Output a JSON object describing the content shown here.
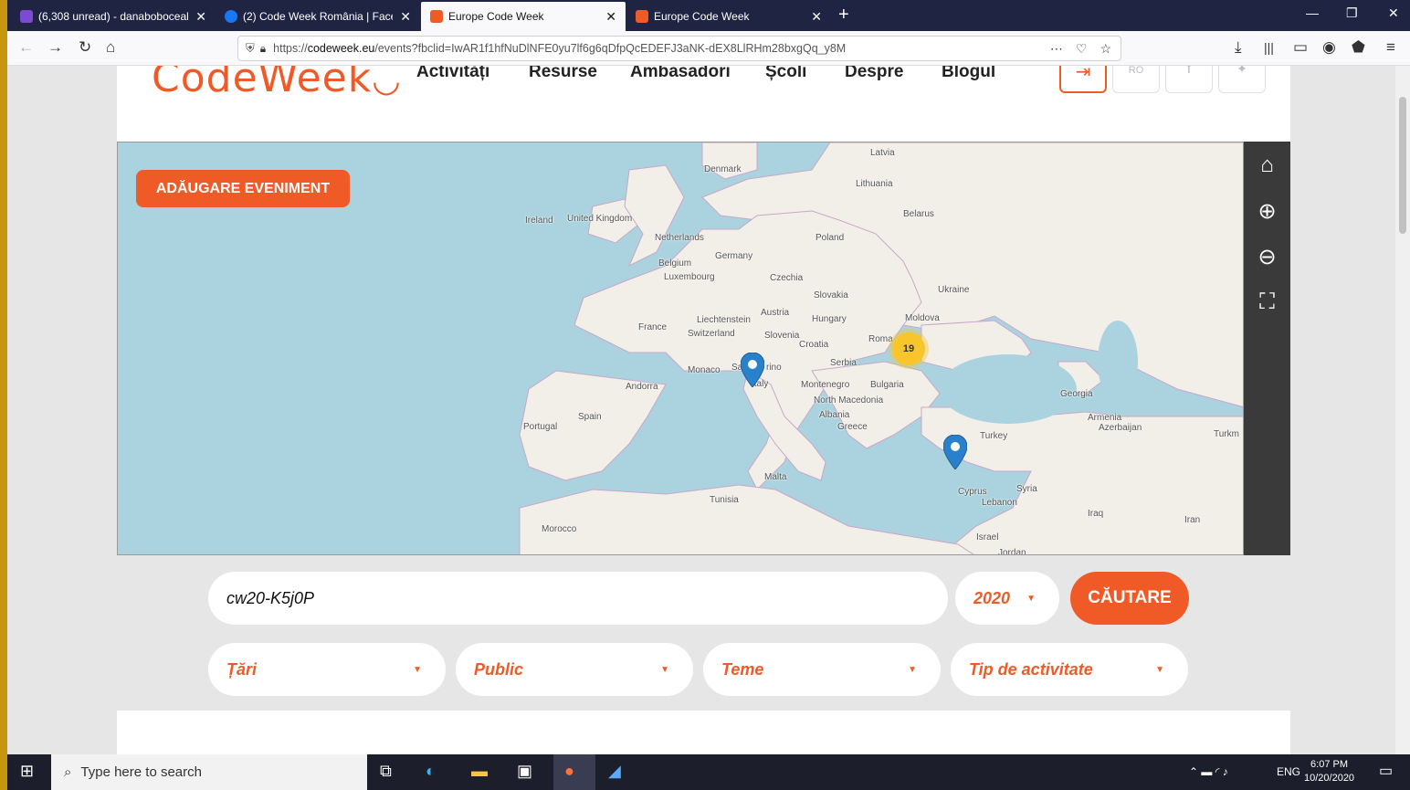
{
  "browser": {
    "tabs": [
      {
        "title": "(6,308 unread) - danaboboceal",
        "color": "#7b4bd1"
      },
      {
        "title": "(2) Code Week România | Facel",
        "color": "#1877f2"
      },
      {
        "title": "Europe Code Week",
        "color": "#ef5a26",
        "active": true
      },
      {
        "title": "Europe Code Week",
        "color": "#ef5a26"
      }
    ],
    "url_prefix": "https://",
    "url_domain": "codeweek.eu",
    "url_rest": "/events?fbclid=IwAR1f1hfNuDlNFE0yu7lf6g6qDfpQcEDEFJ3aNK-dEX8LlRHm28bxgQq_y8M"
  },
  "header": {
    "logo": "CodeWeek",
    "menu": [
      "Activități",
      "Resurse",
      "Ambasadori",
      "Școli",
      "Despre",
      "Blogul"
    ],
    "lang": "RO"
  },
  "map": {
    "add_button": "ADĂUGARE EVENIMENT",
    "cluster_count": "19",
    "labels": [
      "Denmark",
      "Latvia",
      "Lithuania",
      "Ireland",
      "United Kingdom",
      "Belarus",
      "Netherlands",
      "Poland",
      "Germany",
      "Belgium",
      "Luxembourg",
      "Czechia",
      "Slovakia",
      "Ukraine",
      "France",
      "Liechtenstein",
      "Austria",
      "Hungary",
      "Moldova",
      "Switzerland",
      "Slovenia",
      "Croatia",
      "Roma",
      "Serbia",
      "Monaco",
      "Sa",
      "rino",
      "Andorra",
      "Montenegro",
      "Bulgaria",
      "North Macedonia",
      "Italy",
      "Georgia",
      "Albania",
      "Armenia",
      "Azerbaijan",
      "Spain",
      "Greece",
      "Portugal",
      "Turkey",
      "Turkm",
      "Malta",
      "Cyprus",
      "Syria",
      "Lebanon",
      "Tunisia",
      "Iraq",
      "Iran",
      "Morocco",
      "Israel",
      "Jordan"
    ]
  },
  "search": {
    "query": "cw20-K5j0P",
    "year": "2020",
    "button": "CĂUTARE",
    "filters": [
      "Țări",
      "Public",
      "Teme",
      "Tip de activitate"
    ]
  },
  "taskbar": {
    "search_placeholder": "Type here to search",
    "lang": "ENG",
    "time": "6:07 PM",
    "date": "10/20/2020"
  }
}
